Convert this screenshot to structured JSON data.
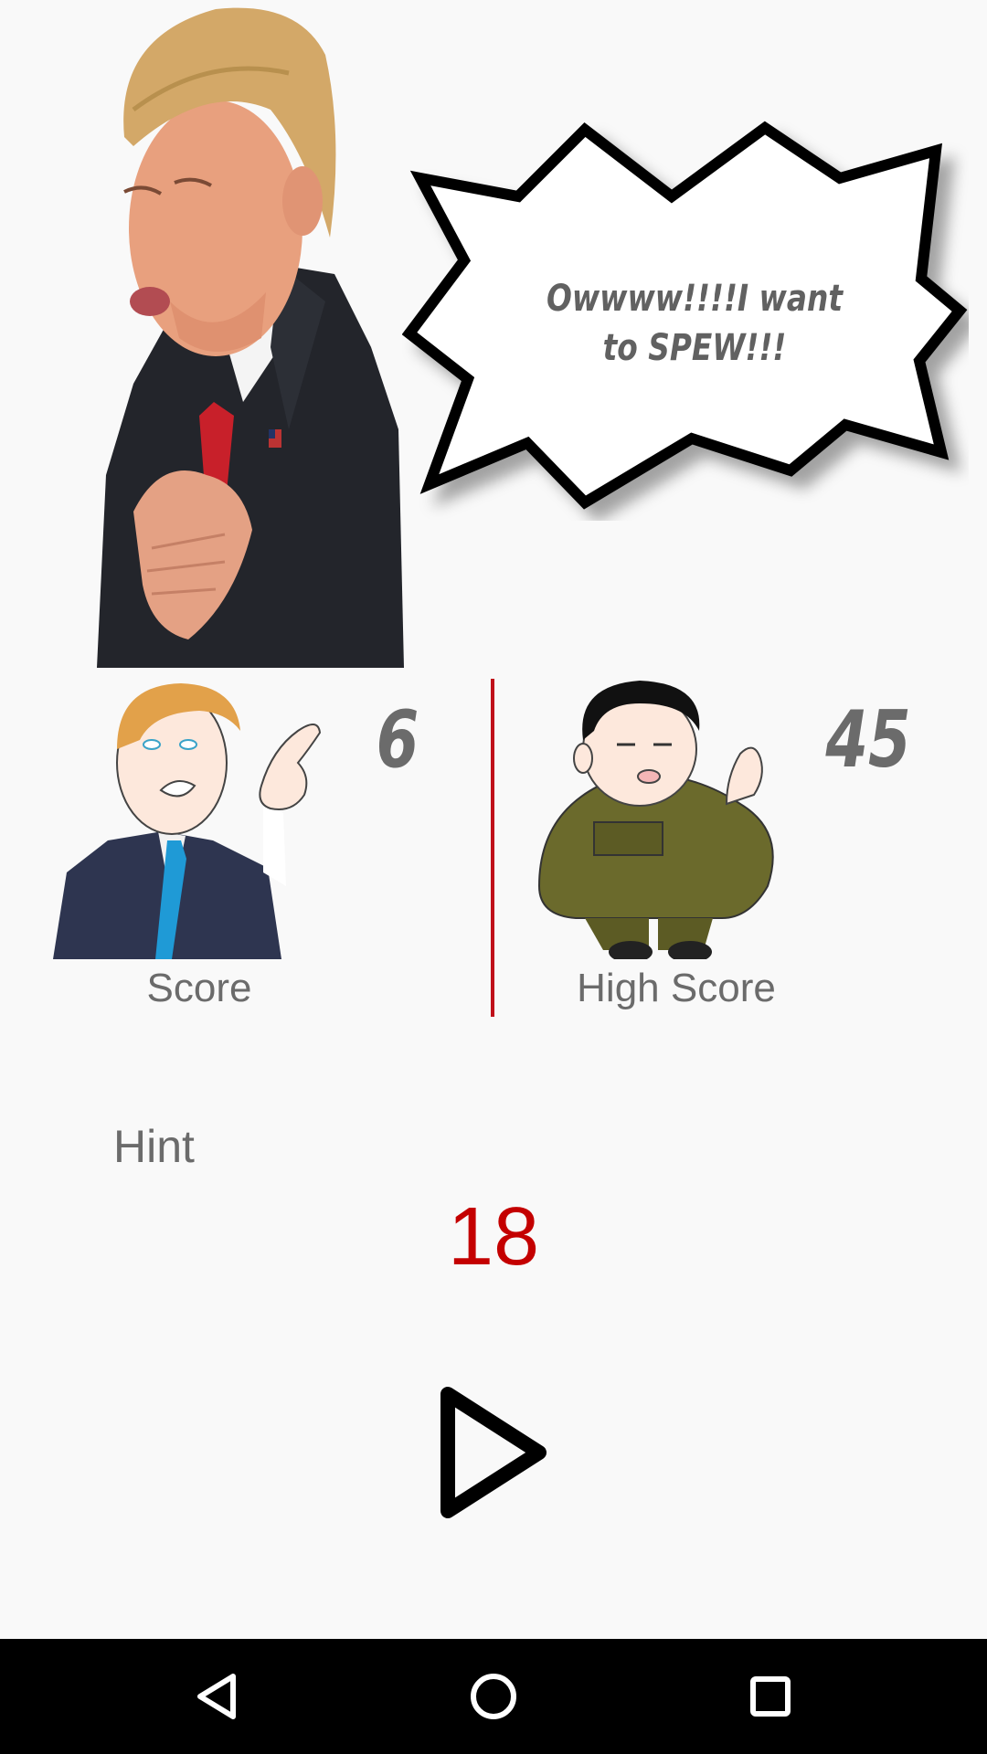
{
  "speech_bubble": {
    "text": "Owwww!!!!I want to SPEW!!!"
  },
  "score": {
    "value": "6",
    "label": "Score"
  },
  "high_score": {
    "value": "45",
    "label": "High Score"
  },
  "hint": {
    "label": "Hint",
    "value": "18"
  },
  "colors": {
    "background": "#f9f9f9",
    "text_gray": "#6b6b6b",
    "accent_red": "#c40000",
    "divider_red": "#c0111a",
    "nav_bar": "#000000"
  },
  "icons": {
    "play": "play-icon",
    "back": "back-icon",
    "home": "home-icon",
    "recents": "recents-icon"
  }
}
